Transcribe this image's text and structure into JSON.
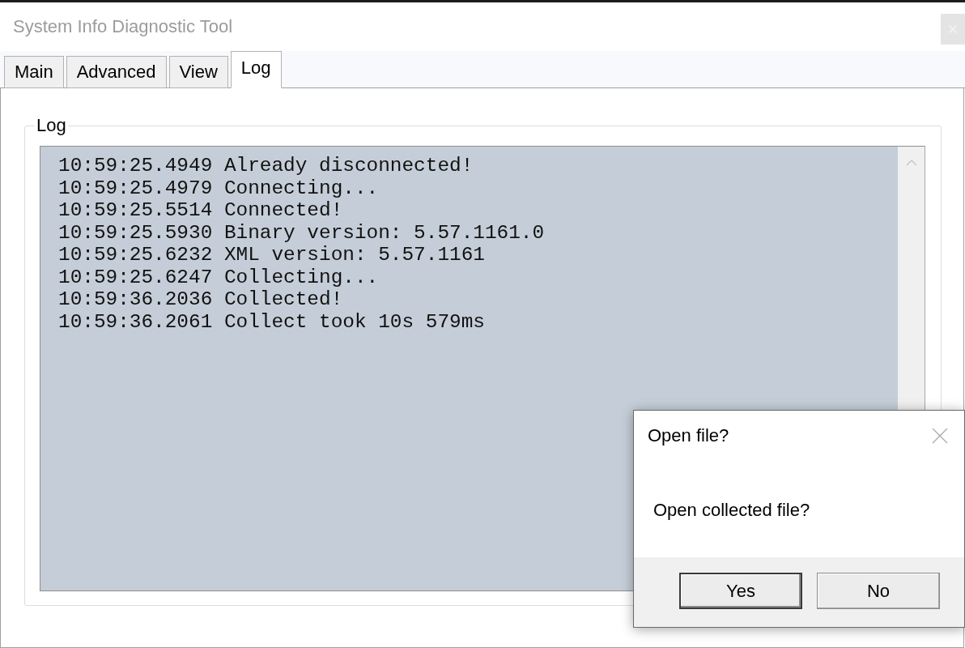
{
  "window": {
    "title": "System Info Diagnostic Tool",
    "active": false
  },
  "tabs": [
    {
      "label": "Main",
      "selected": false
    },
    {
      "label": "Advanced",
      "selected": false
    },
    {
      "label": "View",
      "selected": false
    },
    {
      "label": "Log",
      "selected": true
    }
  ],
  "log_group": {
    "label": "Log",
    "lines": [
      "10:59:25.4949 Already disconnected!",
      "10:59:25.4979 Connecting...",
      "10:59:25.5514 Connected!",
      "10:59:25.5930 Binary version: 5.57.1161.0",
      "10:59:25.6232 XML version: 5.57.1161",
      "10:59:25.6247 Collecting...",
      "10:59:36.2036 Collected!",
      "10:59:36.2061 Collect took 10s 579ms"
    ]
  },
  "dialog": {
    "title": "Open file?",
    "message": "Open collected file?",
    "buttons": [
      {
        "label": "Yes",
        "default": true
      },
      {
        "label": "No",
        "default": false
      }
    ]
  }
}
